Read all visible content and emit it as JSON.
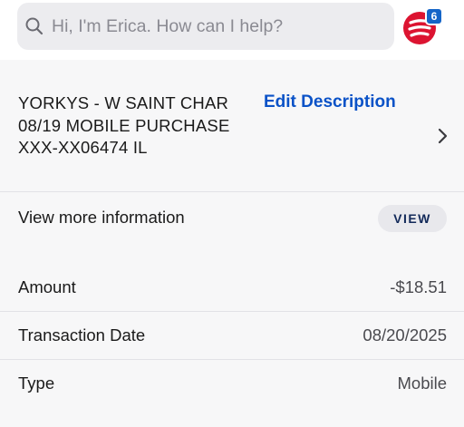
{
  "search": {
    "placeholder": "Hi, I'm Erica. How can I help?",
    "icon": "search-icon"
  },
  "erica": {
    "icon": "erica-logo-icon",
    "badge_count": "6",
    "badge_color": "#1565c8",
    "brand_color": "#dc1431"
  },
  "transaction": {
    "merchant_description": "YORKYS - W SAINT CHAR 08/19 MOBILE PURCHASE XXX-XX06474 IL",
    "edit_label": "Edit Description",
    "view_more_label": "View more information",
    "view_button_label": "VIEW"
  },
  "details": [
    {
      "label": "Amount",
      "value": "-$18.51"
    },
    {
      "label": "Transaction Date",
      "value": "08/20/2025"
    },
    {
      "label": "Type",
      "value": "Mobile"
    }
  ],
  "colors": {
    "link": "#0a52c7",
    "view_button_text": "#132a5a"
  }
}
